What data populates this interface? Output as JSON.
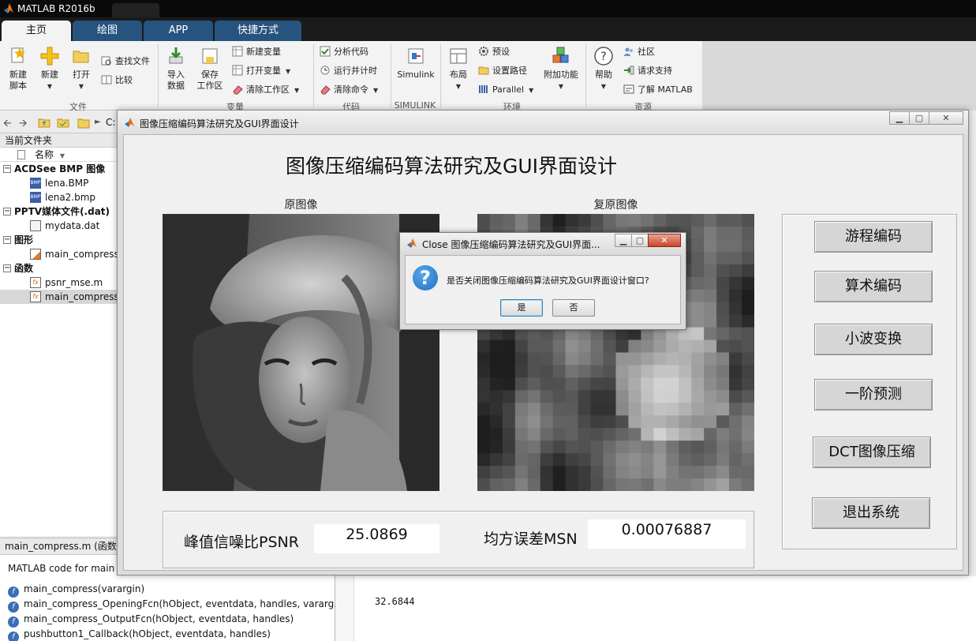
{
  "app": {
    "title": "MATLAB R2016b"
  },
  "tabs": [
    {
      "label": "主页",
      "active": true
    },
    {
      "label": "绘图"
    },
    {
      "label": "APP"
    },
    {
      "label": "快捷方式"
    }
  ],
  "ribbon": {
    "sections": {
      "file": "文件",
      "variable": "变量",
      "code": "代码",
      "simulink": "SIMULINK",
      "environment": "环境",
      "resources": "资源"
    },
    "new_script": "新建\n脚本",
    "new": "新建",
    "open": "打开",
    "find_files": "查找文件",
    "compare": "比较",
    "import_data": "导入\n数据",
    "save_workspace": "保存\n工作区",
    "new_variable": "新建变量",
    "open_variable": "打开变量",
    "clear_workspace": "清除工作区",
    "analyze_code": "分析代码",
    "run_and_time": "运行并计时",
    "clear_commands": "清除命令",
    "simulink": "Simulink",
    "layout": "布局",
    "preferences": "预设",
    "set_path": "设置路径",
    "parallel": "Parallel",
    "add_ons": "附加功能",
    "help": "帮助",
    "community": "社区",
    "request_support": "请求支持",
    "learn_matlab": "了解 MATLAB"
  },
  "pathbar": {
    "drive": "C:"
  },
  "file_browser": {
    "header": "当前文件夹",
    "column_name": "名称",
    "groups": [
      {
        "label": "ACDSee BMP 图像",
        "items": [
          "lena.BMP",
          "lena2.bmp"
        ]
      },
      {
        "label": "PPTV媒体文件(.dat)",
        "items": [
          "mydata.dat"
        ]
      },
      {
        "label": "图形",
        "items": [
          "main_compress"
        ]
      },
      {
        "label": "函数",
        "items": [
          "psnr_mse.m",
          "main_compress"
        ]
      }
    ]
  },
  "details": {
    "header": "main_compress.m  (函数",
    "description": "MATLAB code for main",
    "functions": [
      "main_compress(varargin)",
      "main_compress_OpeningFcn(hObject, eventdata, handles, vararg...",
      "main_compress_OutputFcn(hObject, eventdata, handles)",
      "pushbutton1_Callback(hObject, eventdata, handles)"
    ]
  },
  "command_window": {
    "output": "32.6844"
  },
  "figure": {
    "window_title": "图像压缩编码算法研究及GUI界面设计",
    "title": "图像压缩编码算法研究及GUI界面设计",
    "original_label": "原图像",
    "restored_label": "复原图像",
    "buttons": [
      "游程编码",
      "算术编码",
      "小波变换",
      "一阶预测",
      "DCT图像压缩",
      "退出系统"
    ],
    "psnr_label": "峰值信噪比PSNR",
    "psnr_value": "25.0869",
    "msn_label": "均方误差MSN",
    "msn_value": "0.00076887"
  },
  "dialog": {
    "title": "Close 图像压缩编码算法研究及GUI界面...",
    "message": "是否关闭图像压缩编码算法研究及GUI界面设计窗口?",
    "yes": "是",
    "no": "否"
  },
  "colors": {
    "tab_blue": "#27537f",
    "title_black": "#0a0a0a",
    "question_blue": "#1e6fc0"
  }
}
